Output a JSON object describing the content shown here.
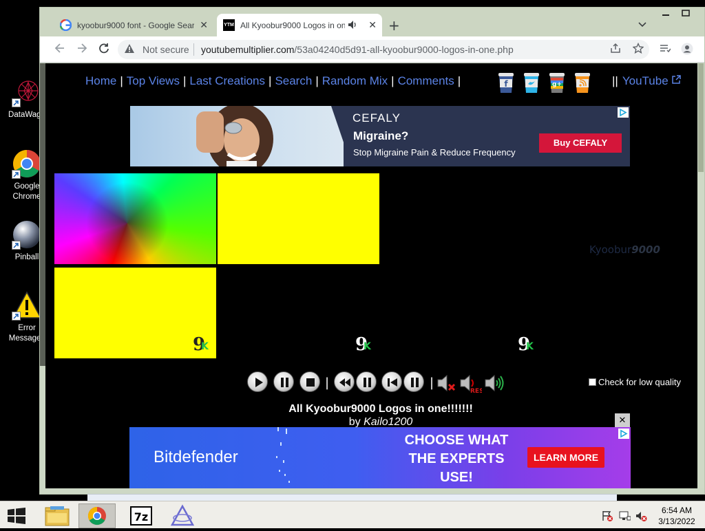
{
  "desktop": {
    "icons": [
      {
        "label": "DataWago"
      },
      {
        "label": "Google Chrome"
      },
      {
        "label": "Pinball"
      },
      {
        "label": "Error Messages"
      }
    ]
  },
  "browser": {
    "tabs": [
      {
        "title": "kyoobur9000 font - Google Sear",
        "favicon": "google-icon"
      },
      {
        "title": "All Kyoobur9000 Logos in on",
        "favicon": "ytm-icon",
        "favicon_text": "YTM",
        "audio": true
      }
    ],
    "security_label": "Not secure",
    "url_domain": "youtubemultiplier.com",
    "url_path": "/53a04240d5d91-all-kyoobur9000-logos-in-one.php"
  },
  "site": {
    "menu": [
      "Home",
      "Top Views",
      "Last Creations",
      "Search",
      "Random Mix",
      "Comments"
    ],
    "youtube_label": "YouTube",
    "youtube_prefix": "||",
    "social_cups": [
      "facebook-cup-icon",
      "twitter-cup-icon",
      "googleplus-cup-icon",
      "rss-cup-icon"
    ],
    "ad_top": {
      "brand": "CEFALY",
      "headline": "Migraine?",
      "subline": "Stop Migraine Pain & Reduce Frequency",
      "cta": "Buy CEFALY"
    },
    "kyoobur_text_k": "Kyoobur",
    "kyoobur_text_num": "9000",
    "nine_glyph": "9",
    "k_glyph": "K",
    "low_quality_label": "Check for low quality",
    "low_quality_checked": false,
    "video_title": "All Kyoobur9000 Logos in one!!!!!!!",
    "video_by_prefix": "by",
    "video_author": "Kailo1200",
    "res_label": "RES",
    "ad_bottom": {
      "brand": "Bitdefender",
      "message": "CHOOSE WHAT THE EXPERTS USE!",
      "cta": "LEARN MORE"
    },
    "close_glyph": "✕"
  },
  "taskbar": {
    "time": "6:54 AM",
    "date": "3/13/2022",
    "apps": [
      "file-explorer-icon",
      "chrome-icon",
      "7zip-icon",
      "app-icon"
    ],
    "seven_zip_label": "7z"
  },
  "colors": {
    "link": "#5b83e6",
    "yellow": "#ffff00",
    "cefaly_bg": "#2b3450",
    "cefaly_cta": "#d4163a",
    "bitdefender_cta": "#e8121f"
  }
}
